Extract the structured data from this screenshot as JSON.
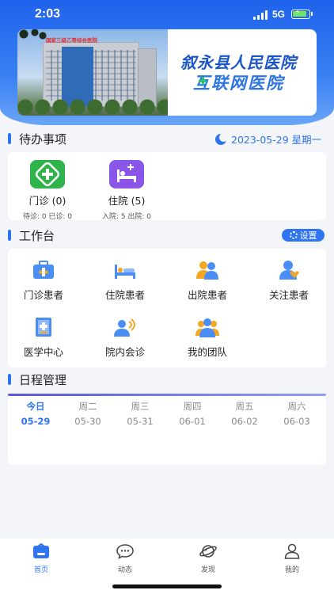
{
  "status_bar": {
    "time": "2:03",
    "network": "5G"
  },
  "banner": {
    "building_sign": "国家三级乙等综合医院",
    "title1": "叙永县人民医院",
    "title2": "互联网医院"
  },
  "todo": {
    "title": "待办事项",
    "date": "2023-05-29 星期一",
    "items": [
      {
        "label": "门诊 (0)",
        "sub": "待诊: 0 已诊: 0",
        "icon": "outpatient-cross-icon",
        "color": "#2fb34a"
      },
      {
        "label": "住院 (5)",
        "sub": "入院: 5 出院: 0",
        "icon": "hospital-bed-icon",
        "color": "#8a55e8"
      }
    ]
  },
  "workbench": {
    "title": "工作台",
    "settings_label": "设置",
    "items": [
      {
        "label": "门诊患者",
        "icon": "medical-kit-icon"
      },
      {
        "label": "住院患者",
        "icon": "hospital-bed-icon"
      },
      {
        "label": "出院患者",
        "icon": "discharged-patients-icon"
      },
      {
        "label": "关注患者",
        "icon": "followed-patient-icon"
      },
      {
        "label": "医学中心",
        "icon": "medical-book-icon"
      },
      {
        "label": "院内会诊",
        "icon": "consultation-icon"
      },
      {
        "label": "我的团队",
        "icon": "team-icon"
      }
    ]
  },
  "schedule": {
    "title": "日程管理",
    "days": [
      {
        "name": "今日",
        "date": "05-29",
        "active": true
      },
      {
        "name": "周二",
        "date": "05-30"
      },
      {
        "name": "周三",
        "date": "05-31"
      },
      {
        "name": "周四",
        "date": "06-01"
      },
      {
        "name": "周五",
        "date": "06-02"
      },
      {
        "name": "周六",
        "date": "06-03"
      }
    ]
  },
  "tabbar": [
    {
      "label": "首页",
      "icon": "home-icon",
      "active": true
    },
    {
      "label": "动态",
      "icon": "chat-bubble-icon"
    },
    {
      "label": "发现",
      "icon": "planet-icon"
    },
    {
      "label": "我的",
      "icon": "user-icon"
    }
  ],
  "colors": {
    "accent": "#2f74f0",
    "header": "#1e63ec",
    "green": "#2fb34a",
    "purple": "#8a55e8"
  }
}
